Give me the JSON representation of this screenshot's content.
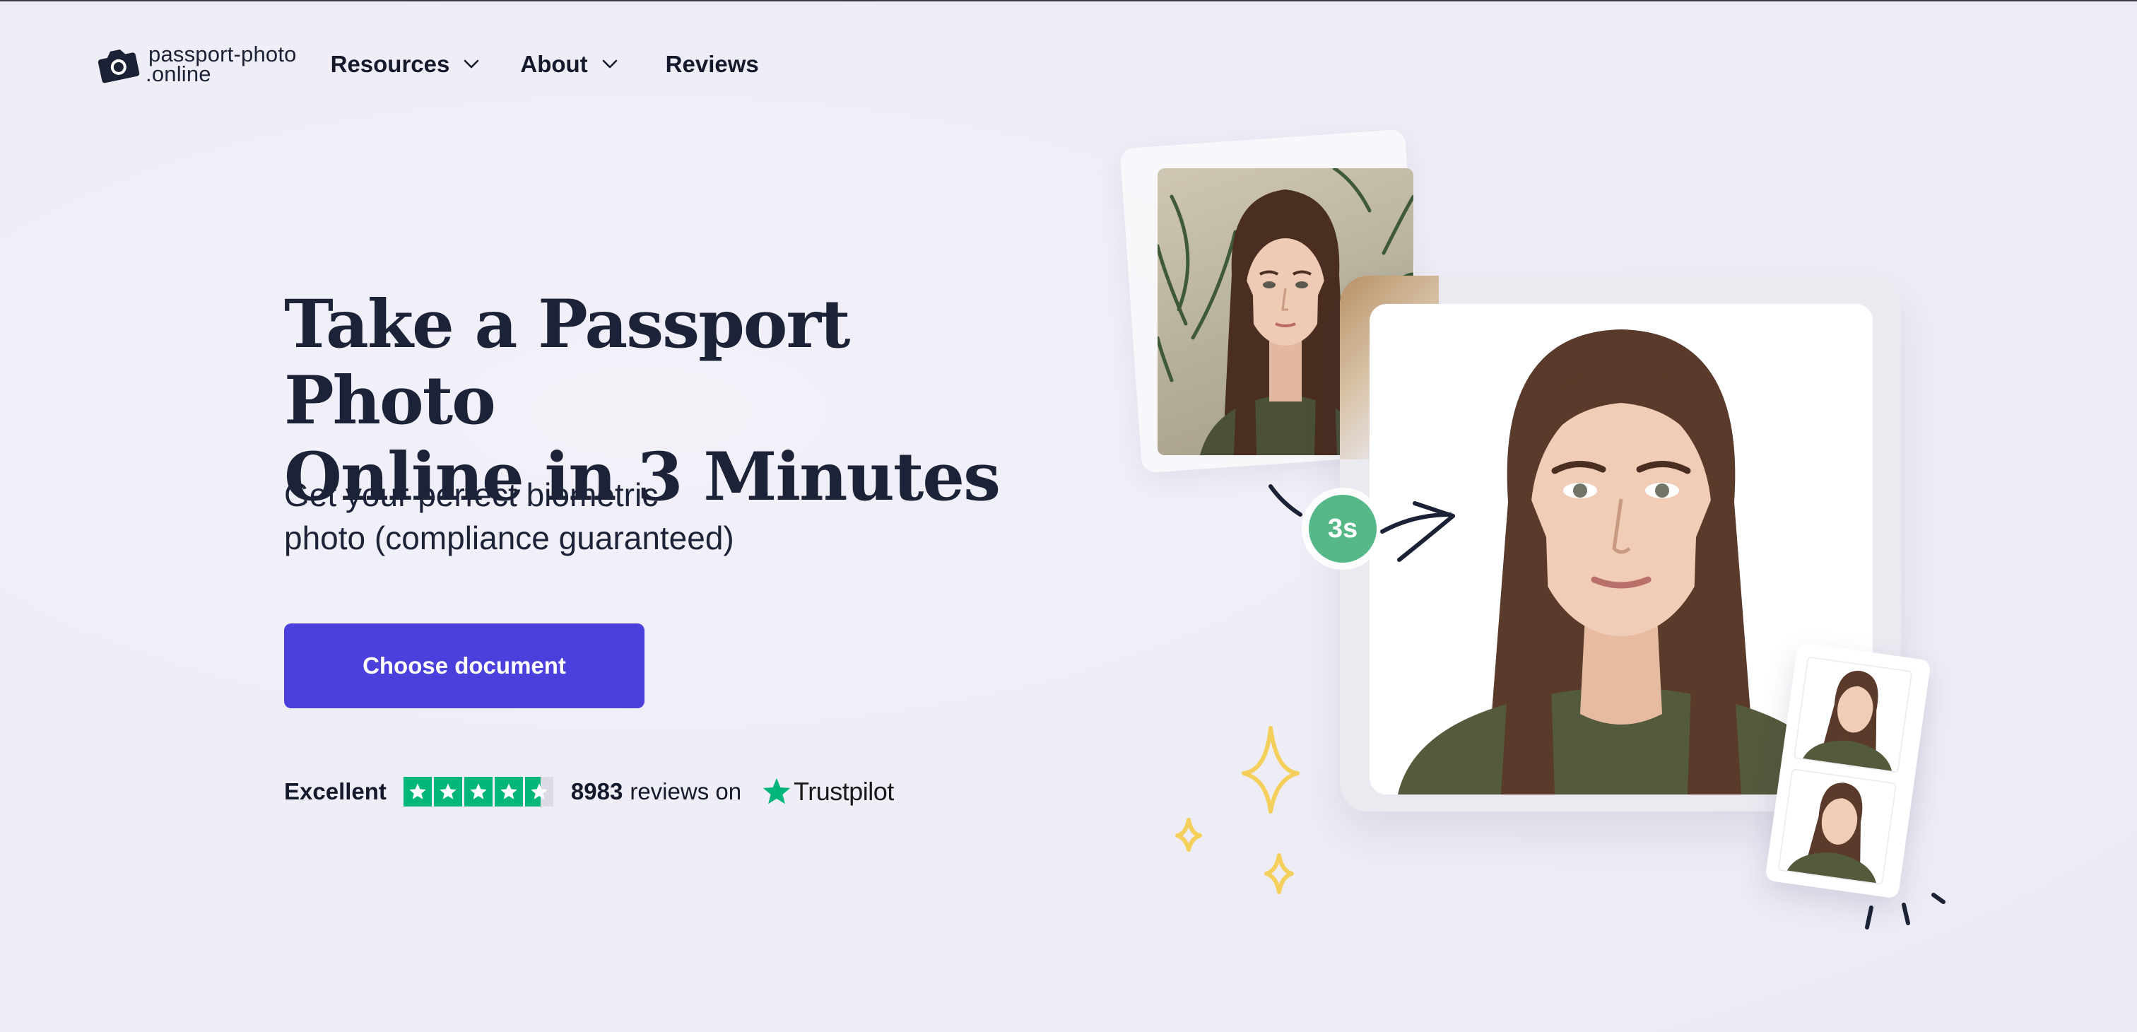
{
  "nav": {
    "logo_line1": "passport-photo",
    "logo_line2": ".online",
    "items": [
      {
        "label": "Resources",
        "has_dropdown": true
      },
      {
        "label": "About",
        "has_dropdown": true
      },
      {
        "label": "Reviews",
        "has_dropdown": false
      }
    ]
  },
  "hero": {
    "title_line1": "Take a Passport Photo",
    "title_line2": "Online in 3 Minutes",
    "subtitle_line1": "Get your perfect biometric",
    "subtitle_line2": "photo (compliance guaranteed)",
    "cta_label": "Choose document"
  },
  "rating": {
    "label": "Excellent",
    "stars": 4.5,
    "count": "8983",
    "reviews_text": "reviews on",
    "provider": "Trustpilot"
  },
  "illustration": {
    "timer_badge": "3s"
  },
  "colors": {
    "accent": "#4c40dc",
    "trustpilot_green": "#00b67a",
    "badge_green": "#55b886",
    "sparkle_yellow": "#f5cf5c",
    "text_dark": "#1c2237"
  }
}
